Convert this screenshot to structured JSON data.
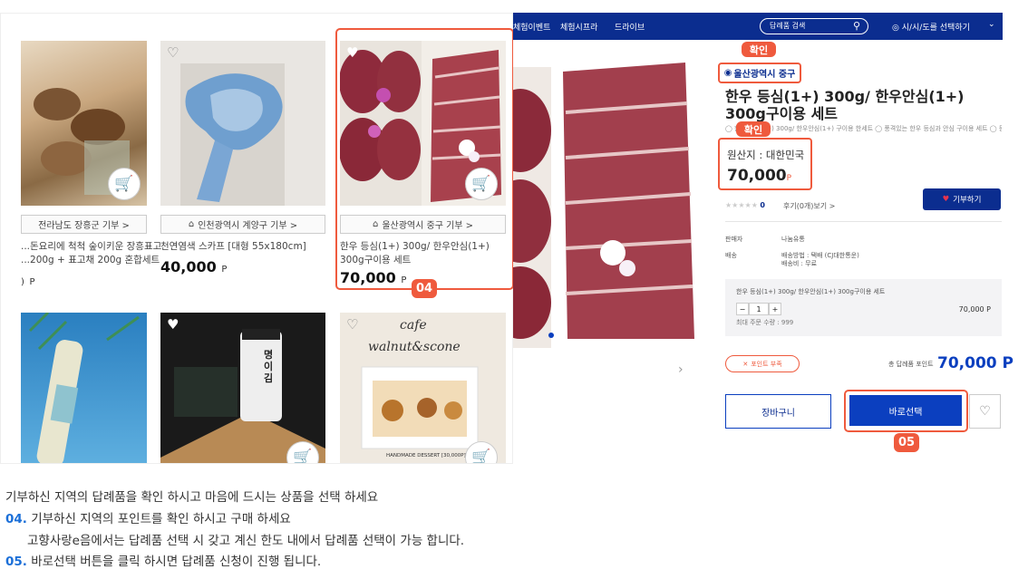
{
  "left_shot": {
    "cards": [
      {
        "region": "전라남도 장흥군 기부 >",
        "name": "...돈요리에 척척 숲이키운 장흥표고\n...200g + 표고채 200g 혼합세트",
        "price": "",
        "price_unit": "P"
      },
      {
        "region": "인천광역시 계양구 기부 >",
        "name": "천연염색 스카프 [대형 55x180cm]",
        "price": "40,000",
        "price_unit": "P"
      },
      {
        "region": "울산광역시 중구 기부 >",
        "name": "한우 등심(1+) 300g/ 한우안심(1+) 300g구이용 세트",
        "price": "70,000",
        "price_unit": "P"
      }
    ],
    "bottom_card_texts": {
      "seaweed_label": "명이김",
      "cafe_title": "cafe",
      "cafe_subtitle": "walnut&scone",
      "cafe_footer": "HANDMADE DESSERT [30,000P]"
    },
    "highlight_label": "04"
  },
  "right_shot": {
    "nav": [
      "체험이벤트",
      "체험시프라",
      "드라이브"
    ],
    "search_placeholder": "답례품 검색",
    "region_select": "◎ 시/시/도를 선택하기",
    "check_badges": [
      "확인",
      "확인"
    ],
    "region": "울산광역시 중구",
    "title": "한우 등심(1+) 300g/ 한우안심(1+) 300g구이용 세트",
    "subinfo": "◯ 한우 등심(1+) 300g/ 한우안심(1+) 구이용 한세트 ◯ 풍격있는 한우 등심과 안심 구이용 세트 ◯ 등심 300g + 안심",
    "origin": "원산지 : 대한민국",
    "price": "70,000",
    "price_unit": "P",
    "rating_count": "0",
    "reviews": "후기(0개)보기 >",
    "donate_button": "기부하기",
    "seller_label": "판매자",
    "seller": "나눔유통",
    "shipping_label": "배송",
    "shipping_lines": [
      "배송방법 : 택배 (CJ대한통운)",
      "배송비 : 무료"
    ],
    "option_name": "한우 등심(1+) 300g/ 한우안심(1+) 300g구이용 세트",
    "quantity": "1",
    "option_price": "70,000 P",
    "max_qty": "최대 주문 수량 : 999",
    "point_button": "포인트 부족",
    "total_label": "총 답례품 포인트",
    "total_value": "70,000 P",
    "cart_button": "장바구니",
    "buy_button": "바로선택",
    "highlight_label": "05"
  },
  "instructions": {
    "line1": "기부하신 지역의 답례품을 확인 하시고 마음에 드시는 상품을 선택 하세요",
    "step04_num": "04.",
    "step04_text": "기부하신 지역의 포인트를 확인 하시고 구매 하세요",
    "line3": "고향사랑e음에서는 답례품 선택 시 갖고 계신 한도 내에서 답례품 선택이 가능 합니다.",
    "step05_num": "05.",
    "step05_text": "바로선택 버튼을 클릭 하시면 답례품 신청이 진행 됩니다."
  },
  "colors": {
    "accent": "#ef5a3d",
    "navy": "#0b2d8f",
    "blue": "#0b3fbf",
    "step_blue": "#1b6fd8"
  }
}
